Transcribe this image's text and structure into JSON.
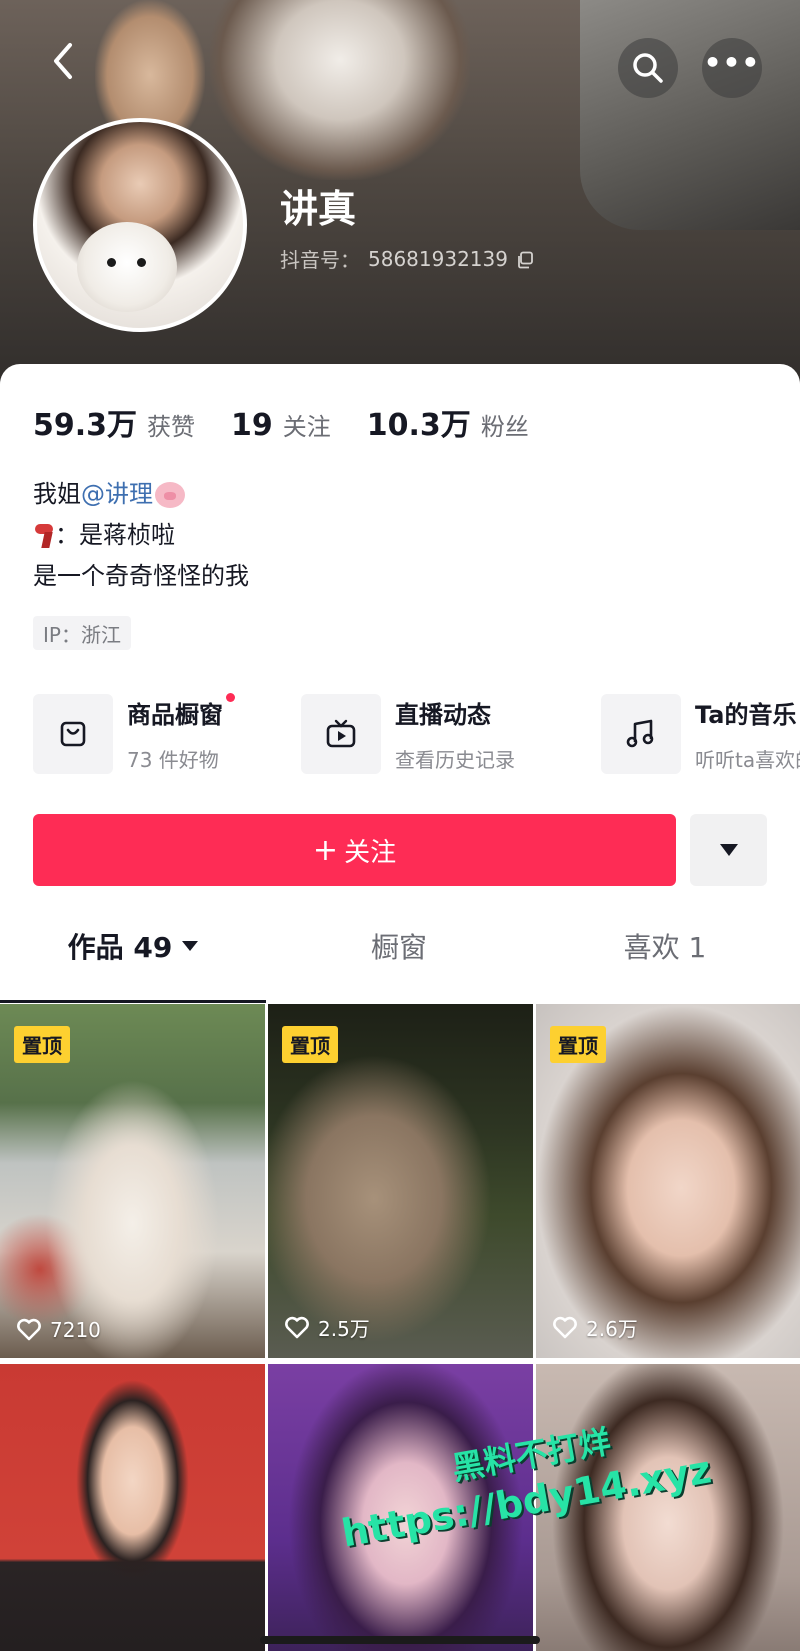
{
  "profile": {
    "nickname": "讲真",
    "douyin_id_label": "抖音号：",
    "douyin_id": "58681932139"
  },
  "stats": [
    {
      "value": "59.3万",
      "label": "获赞"
    },
    {
      "value": "19",
      "label": "关注"
    },
    {
      "value": "10.3万",
      "label": "粉丝"
    }
  ],
  "bio": {
    "line1_prefix": "我姐",
    "line1_mention": "@讲理",
    "line2": "：是蒋桢啦",
    "line3": "是一个奇奇怪怪的我"
  },
  "ip": "IP：浙江",
  "services": [
    {
      "title": "商品橱窗",
      "subtitle": "73 件好物",
      "icon": "shopping-bag-icon"
    },
    {
      "title": "直播动态",
      "subtitle": "查看历史记录",
      "icon": "tv-icon"
    },
    {
      "title": "Ta的音乐",
      "subtitle": "听听ta喜欢的音乐",
      "icon": "music-note-icon"
    }
  ],
  "actions": {
    "follow_label": "关注",
    "follow_plus": "+"
  },
  "tabs": [
    {
      "label": "作品 49",
      "active": true
    },
    {
      "label": "橱窗",
      "active": false
    },
    {
      "label": "喜欢 1",
      "active": false
    }
  ],
  "videos": [
    {
      "pinned": true,
      "pin_label": "置顶",
      "likes": "7210"
    },
    {
      "pinned": true,
      "pin_label": "置顶",
      "likes": "2.5万"
    },
    {
      "pinned": true,
      "pin_label": "置顶",
      "likes": "2.6万"
    },
    {
      "pinned": false,
      "likes": ""
    },
    {
      "pinned": false,
      "likes": ""
    },
    {
      "pinned": false,
      "likes": ""
    }
  ],
  "watermark": {
    "line1": "黑料不打烊",
    "line2": "https://bdy14.xyz"
  },
  "colors": {
    "accent": "#fe2c55",
    "pin_badge": "#fdd030",
    "mention": "#3e6fb0",
    "watermark": "#27e3a6"
  }
}
